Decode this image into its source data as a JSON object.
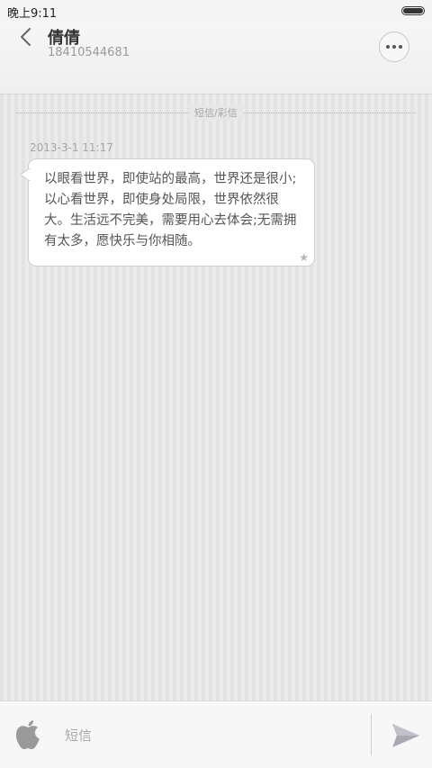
{
  "status_bar": {
    "time": "晚上9:11",
    "battery_level": 1.0
  },
  "header": {
    "contact_name": "倩倩",
    "contact_number": "18410544681",
    "icons": {
      "back": "chevron-left-icon",
      "more": "more-icon"
    }
  },
  "conversation": {
    "divider_label": "短信/彩信",
    "messages": [
      {
        "timestamp": "2013-3-1 11:17",
        "text": "以眼看世界，即使站的最高，世界还是很小;以心看世界，即使身处局限，世界依然很大。生活远不完美，需要用心去体会;无需拥有太多，愿快乐与你相随。",
        "starred": true
      }
    ]
  },
  "compose": {
    "placeholder": "短信",
    "value": "",
    "icons": {
      "left": "apple-icon",
      "send": "send-icon"
    }
  },
  "colors": {
    "background": "#e6e6e6",
    "bubble": "#ffffff",
    "text_primary": "#333333",
    "text_secondary": "#9a9a9a"
  }
}
